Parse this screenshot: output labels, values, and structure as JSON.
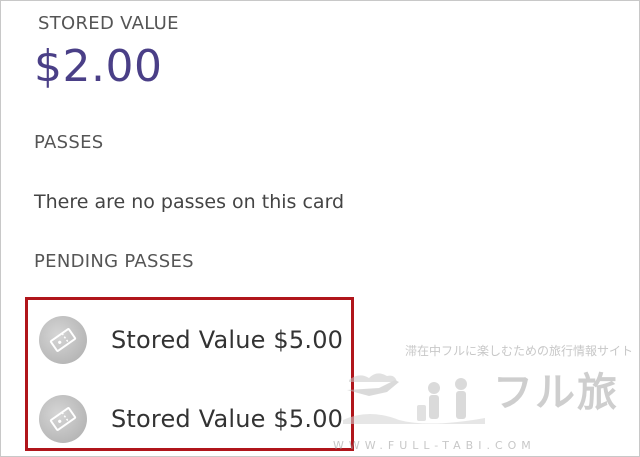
{
  "stored_value": {
    "label": "STORED VALUE",
    "amount": "$2.00"
  },
  "passes": {
    "label": "PASSES",
    "empty_message": "There are no passes on this card"
  },
  "pending_passes": {
    "label": "PENDING PASSES",
    "items": [
      {
        "label": "Stored Value $5.00",
        "icon": "ticket-icon"
      },
      {
        "label": "Stored Value $5.00",
        "icon": "ticket-icon"
      }
    ]
  },
  "watermark": {
    "tagline": "滞在中フルに楽しむための旅行情報サイト",
    "logo": "フル旅",
    "url": "WWW.FULL-TABI.COM"
  },
  "colors": {
    "amount": "#4a3f87",
    "highlight_border": "#b0151b"
  }
}
